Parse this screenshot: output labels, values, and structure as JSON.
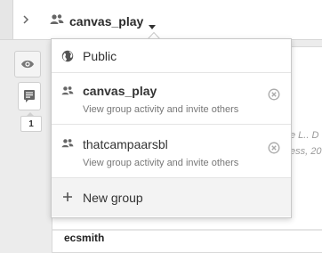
{
  "header": {
    "group_name": "canvas_play"
  },
  "sidebar": {
    "annotation_count": "1"
  },
  "dropdown": {
    "public_label": "Public",
    "groups": [
      {
        "name": "canvas_play",
        "subtitle": "View group activity and invite others"
      },
      {
        "name": "thatcampaarsbl",
        "subtitle": "View group activity and invite others"
      }
    ],
    "new_group_label": "New group"
  },
  "background": {
    "snippet_1": "e L.. D",
    "snippet_2": "ess, 20",
    "author": "ecsmith"
  },
  "colors": {
    "icon_gray": "#555555",
    "muted_text": "#777777"
  }
}
